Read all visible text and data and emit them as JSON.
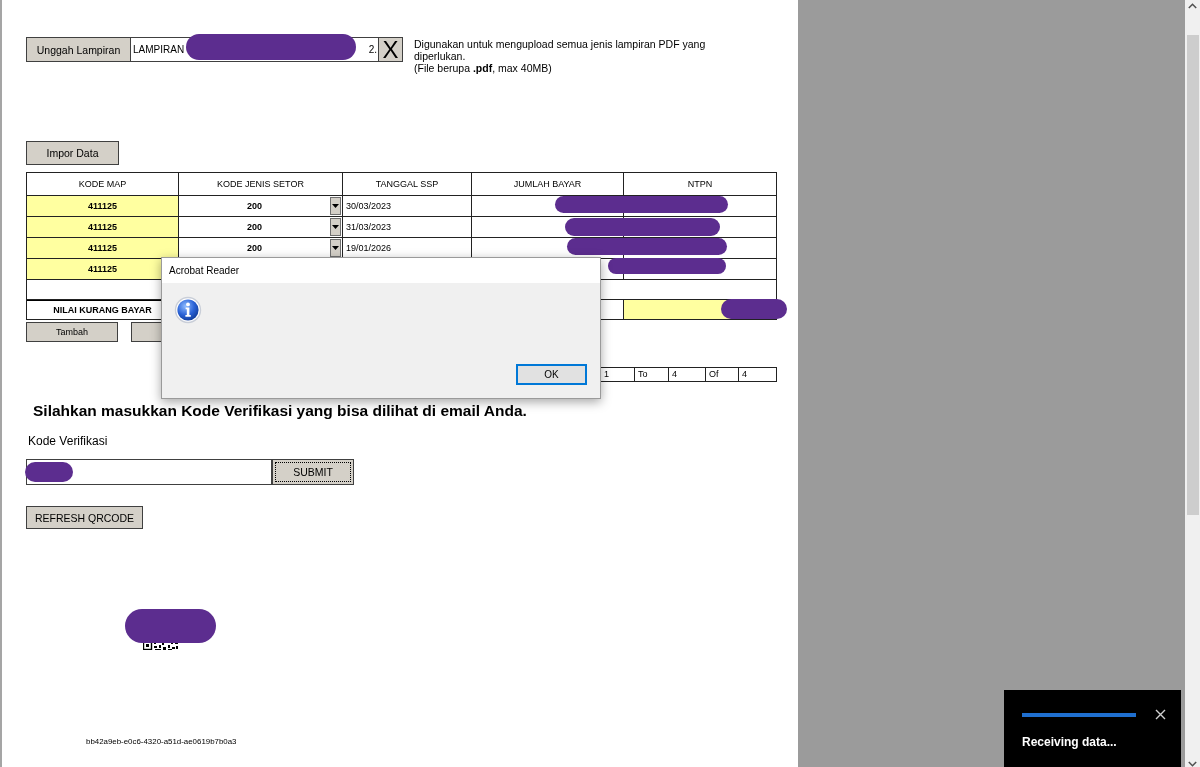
{
  "upload": {
    "button": "Unggah Lampiran",
    "file_name": {
      "start": "LAMPIRAN",
      "end": "2.",
      "redacted": true
    },
    "clear_button": "X",
    "note": "Digunakan untuk mengupload semua jenis lampiran PDF yang diperlukan.",
    "hint": "(File berupa **.pdf**, max 40MB)"
  },
  "import_button": "Impor Data",
  "table": {
    "columns": [
      "KODE MAP",
      "KODE JENIS SETOR",
      "TANGGAL SSP",
      "JUMLAH BAYAR",
      "NTPN"
    ],
    "rows": [
      {
        "kode_map": "411125",
        "kode_jenis_setor": "200",
        "tanggal_ssp": "30/03/2023",
        "redacted": true
      },
      {
        "kode_map": "411125",
        "kode_jenis_setor": "200",
        "tanggal_ssp": "31/03/2023",
        "redacted": true
      },
      {
        "kode_map": "411125",
        "kode_jenis_setor": "200",
        "tanggal_ssp": "19/01/2026",
        "redacted": true
      },
      {
        "kode_map": "411125",
        "redacted": true
      }
    ],
    "total": {
      "label": "NILAI KURANG BAYAR",
      "redacted": true
    }
  },
  "row_buttons": [
    {
      "kind": "add",
      "label": "Tambah"
    },
    {
      "kind": "covered"
    }
  ],
  "pagination": [
    "1",
    "To",
    "4",
    "Of",
    "4"
  ],
  "verification": {
    "heading": "Silahkan masukkan Kode Verifikasi yang bisa dilihat di email Anda.",
    "label": "Kode Verifikasi",
    "value_redacted": true,
    "submit_button": {
      "label": "SUBMIT",
      "focused": true
    },
    "refresh_button": "REFRESH QRCODE"
  },
  "qr_code": {
    "redacted": true,
    "code_id": "bb42a9eb-e0c6-4320-a51d-ae0619b7b0a3"
  },
  "dialog": {
    "title": "Acrobat Reader",
    "ok_button": {
      "label": "OK",
      "focused": true
    }
  },
  "toast": {
    "level": 1,
    "text": "Receiving data..."
  }
}
